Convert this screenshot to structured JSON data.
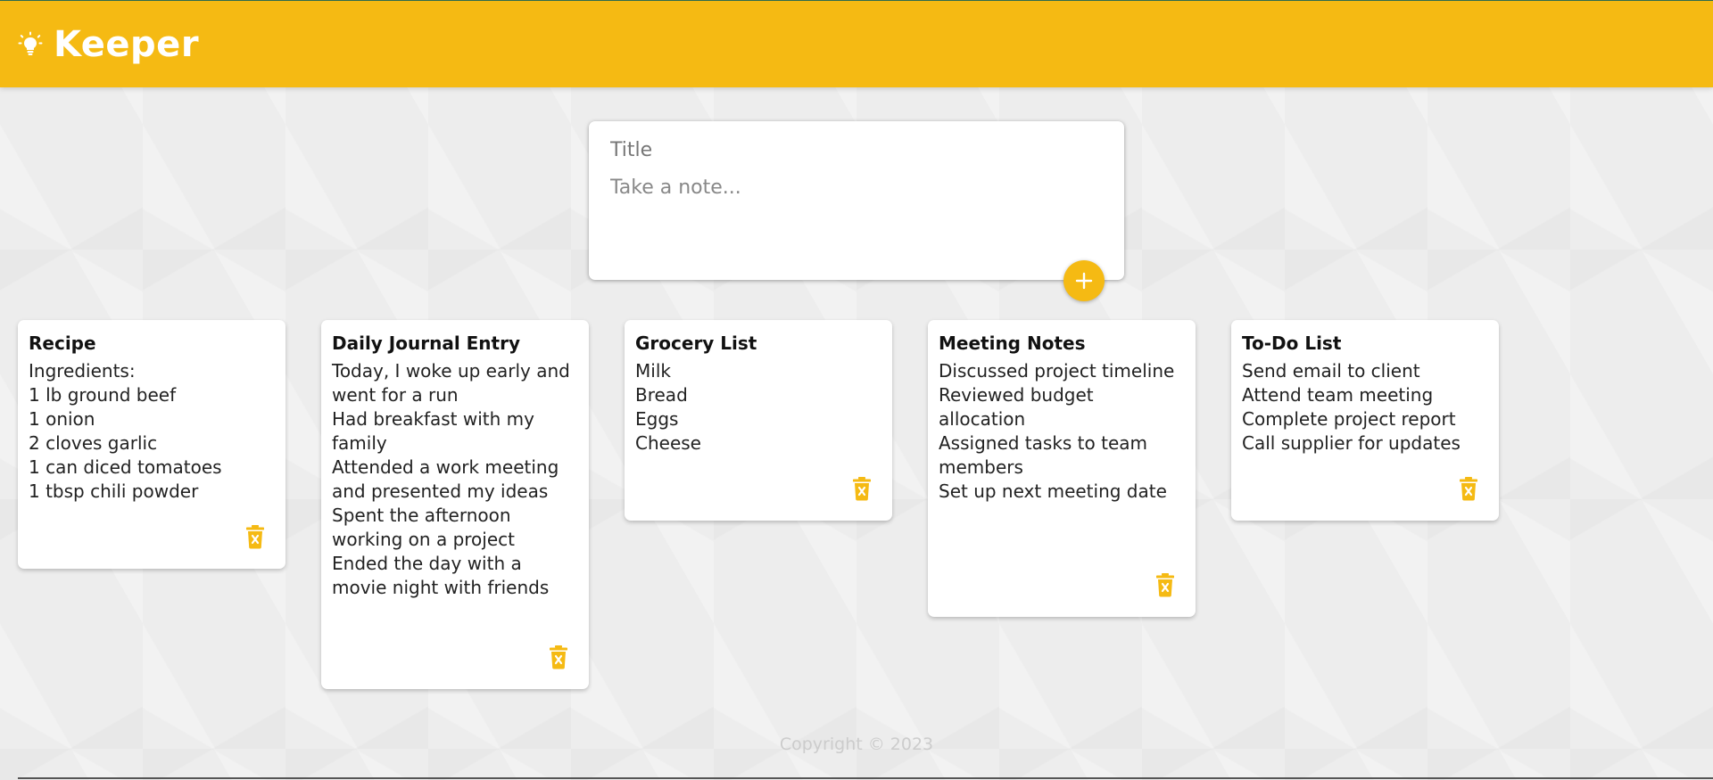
{
  "header": {
    "app_title": "Keeper",
    "logo_icon": "lightbulb-icon"
  },
  "create_note": {
    "title_placeholder": "Title",
    "content_placeholder": "Take a note...",
    "add_icon": "plus-icon"
  },
  "notes": [
    {
      "title": "Recipe",
      "content": "Ingredients:\n1 lb ground beef\n1 onion\n2 cloves garlic\n1 can diced tomatoes\n1 tbsp chili powder",
      "delete_icon": "trash-icon"
    },
    {
      "title": "Daily Journal Entry",
      "content": "Today, I woke up early and went for a run\nHad breakfast with my family\nAttended a work meeting and presented my ideas\nSpent the afternoon working on a project\nEnded the day with a movie night with friends",
      "delete_icon": "trash-icon"
    },
    {
      "title": "Grocery List",
      "content": "Milk\nBread\nEggs\nCheese",
      "delete_icon": "trash-icon"
    },
    {
      "title": "Meeting Notes",
      "content": "Discussed project timeline\nReviewed budget allocation\nAssigned tasks to team members\nSet up next meeting date",
      "delete_icon": "trash-icon"
    },
    {
      "title": "To-Do List",
      "content": "Send email to client\nAttend team meeting\nComplete project report\nCall supplier for updates",
      "delete_icon": "trash-icon"
    }
  ],
  "footer": {
    "copyright": "Copyright © 2023"
  },
  "colors": {
    "accent": "#f5ba13",
    "background": "#ededed",
    "card": "#ffffff",
    "footer_text": "#cccccc"
  }
}
